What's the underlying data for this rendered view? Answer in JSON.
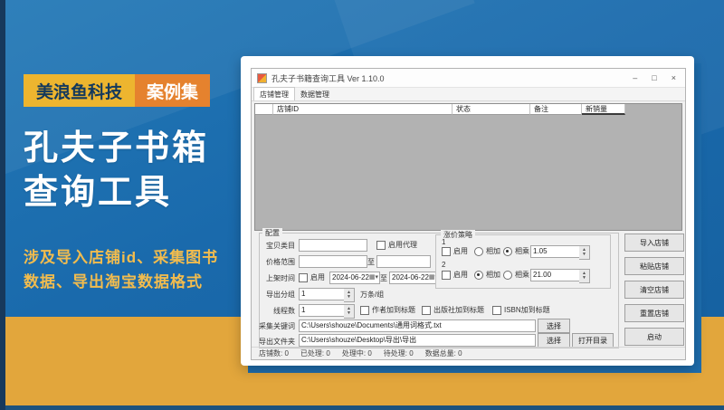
{
  "poster": {
    "brand": "美浪鱼科技",
    "collection": "案例集",
    "title_line1": "孔夫子书箱",
    "title_line2": "查询工具",
    "subtitle_line1": "涉及导入店铺id、采集图书",
    "subtitle_line2": "数据、导出淘宝数据格式",
    "colors": {
      "background_blue": "#1a6aac",
      "band_gold": "#e2a63c",
      "footer_navy": "#1c527e",
      "badge_gold": "#edb52f",
      "badge_orange": "#e5822e",
      "subtitle_gold": "#f2bc4e"
    }
  },
  "window": {
    "title": "孔夫子书籍查询工具 Ver 1.10.0",
    "controls": {
      "minimize": "–",
      "maximize": "□",
      "close": "×"
    },
    "menu_tabs": [
      {
        "label": "店铺管理"
      },
      {
        "label": "数据管理"
      }
    ],
    "table": {
      "headers": [
        "店铺ID",
        "状态",
        "备注",
        "新销量"
      ]
    },
    "config": {
      "group_label": "配置",
      "item_category_label": "宝贝类目",
      "proxy_checkbox_label": "启用代理",
      "price_range_label": "价格范围",
      "to_label": "至",
      "listing_time_label": "上架时间",
      "enable_label": "启用",
      "date_from": "2024-06-22",
      "date_to": "2024-06-22",
      "calendar_glyph": "▦▾",
      "export_group_label": "导出分组",
      "export_group_value": "1",
      "export_group_unit": "万条/组",
      "threads_label": "线程数",
      "threads_value": "1",
      "author_checkbox_label": "作者加到标题",
      "publisher_checkbox_label": "出版社加到标题",
      "isbn_checkbox_label": "ISBN加到标题",
      "keywords_label": "采集关键词",
      "keywords_path": "C:\\Users\\shouze\\Documents\\通用词格式.txt",
      "select_button_label": "选择",
      "export_folder_label": "导出文件夹",
      "export_folder_path": "C:\\Users\\shouze\\Desktop\\导出\\导出",
      "open_dir_button_label": "打开目录",
      "strategy": {
        "group_label": "涨价策略",
        "items": [
          {
            "index": "1",
            "enable_label": "启用",
            "add_label": "相加",
            "multiply_label": "相乘",
            "mode": "multiply",
            "value": "1.05"
          },
          {
            "index": "2",
            "enable_label": "启用",
            "add_label": "相加",
            "multiply_label": "相乘",
            "mode": "add",
            "value": "21.00"
          }
        ]
      }
    },
    "side_buttons": [
      "导入店铺",
      "粘贴店铺",
      "清空店铺",
      "重置店铺",
      "启动"
    ],
    "status_bar": [
      {
        "label": "店铺数:",
        "value": "0"
      },
      {
        "label": "已处理:",
        "value": "0"
      },
      {
        "label": "处理中:",
        "value": "0"
      },
      {
        "label": "待处理:",
        "value": "0"
      },
      {
        "label": "数据总量:",
        "value": "0"
      }
    ]
  }
}
